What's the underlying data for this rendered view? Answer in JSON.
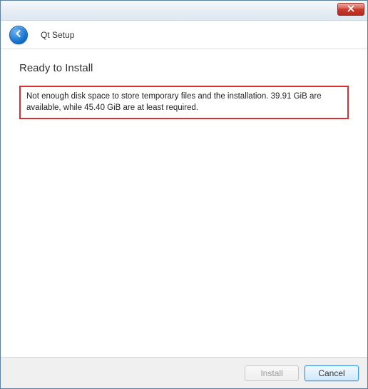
{
  "titlebar": {
    "close_icon": "close"
  },
  "header": {
    "title": "Qt Setup"
  },
  "content": {
    "heading": "Ready to Install",
    "error_message": "Not enough disk space to store temporary files and the installation. 39.91 GiB are available, while 45.40 GiB are at least required."
  },
  "footer": {
    "install_label": "Install",
    "cancel_label": "Cancel"
  }
}
